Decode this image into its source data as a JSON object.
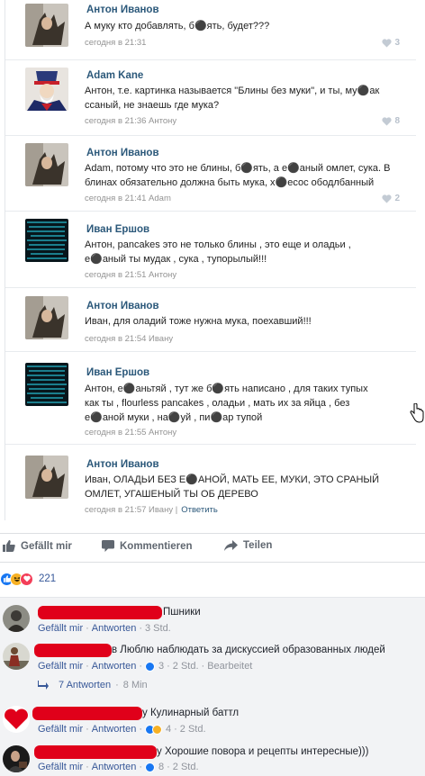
{
  "vk": {
    "messages": [
      {
        "name": "Антон Иванов",
        "text": "А муку кто добавлять, б⚫ять, будет???",
        "meta": "сегодня в 21:31",
        "reply": "",
        "likes": "3"
      },
      {
        "name": "Adam Kane",
        "text": "Антон, т.е. картинка называется \"Блины без муки\", и ты, му⚫ак\nссаный, не знаешь где мука?",
        "meta": "сегодня в 21:36 Антону",
        "reply": "",
        "likes": "8"
      },
      {
        "name": "Антон Иванов",
        "text": "Adam, потому что это не блины, б⚫ять, а е⚫аный омлет, сука. В\nблинах обязательно должна быть мука, х⚫есос ободлбанный",
        "meta": "сегодня в 21:41 Adam",
        "reply": "",
        "likes": "2"
      },
      {
        "name": "Иван Ершов",
        "text": "Антон, pancakes это не только блины , это еще и оладьи ,\nе⚫аный ты мудак , сука , тупорылый!!!",
        "meta": "сегодня в 21:51 Антону",
        "reply": "",
        "likes": ""
      },
      {
        "name": "Антон Иванов",
        "text": "Иван, для оладий тоже нужна мука, поехавший!!!",
        "meta": "сегодня в 21:54 Ивану",
        "reply": "",
        "likes": ""
      },
      {
        "name": "Иван Ершов",
        "text": "Антон, е⚫аньтяй , тут же б⚫ять написано , для таких тупых\nкак ты , flourless pancakes , оладьи , мать их за яйца , без\nе⚫аной муки , на⚫уй , пи⚫ар тупой",
        "meta": "сегодня в 21:55 Антону",
        "reply": "",
        "likes": ""
      },
      {
        "name": "Антон Иванов",
        "text": "Иван, ОЛАДЬИ БЕЗ Е⚫АНОЙ, МАТЬ ЕЕ, МУКИ, ЭТО СРАНЫЙ\nОМЛЕТ, УГАШЕНЫЙ ТЫ ОБ ДЕРЕВО",
        "meta": "сегодня в 21:57 Ивану |",
        "reply": "Ответить",
        "likes": ""
      }
    ]
  },
  "actions": {
    "like": "Gefällt mir",
    "comment": "Kommentieren",
    "share": "Teilen"
  },
  "reactions": {
    "count": "221",
    "types": [
      "like-icon",
      "haha-icon",
      "love-icon"
    ]
  },
  "comments": [
    {
      "text": "Пшники",
      "like": "Gefällt mir",
      "reply": "Antworten",
      "count": "",
      "time": "3 Std.",
      "extra": "",
      "reactions": []
    },
    {
      "text": "в Люблю наблюдать за дискуссией образованных людей",
      "like": "Gefällt mir",
      "reply": "Antworten",
      "count": "3",
      "time": "2 Std.",
      "extra": "Bearbeitet",
      "reactions": [
        "like-icon"
      ]
    },
    {
      "text": "у Кулинарный баттл",
      "like": "Gefällt mir",
      "reply": "Antworten",
      "count": "4",
      "time": "2 Std.",
      "extra": "",
      "reactions": [
        "like-icon",
        "haha-icon"
      ]
    },
    {
      "text": "у Хорошие повора и рецепты интересные)))",
      "like": "Gefällt mir",
      "reply": "Antworten",
      "count": "8",
      "time": "2 Std.",
      "extra": "",
      "reactions": [
        "like-icon"
      ]
    }
  ],
  "replies": {
    "label": "7 Antworten",
    "time": "8 Min"
  },
  "colors": {
    "fb_link": "#385898",
    "vk_name": "#2b587a",
    "redaction": "#e0001a"
  }
}
